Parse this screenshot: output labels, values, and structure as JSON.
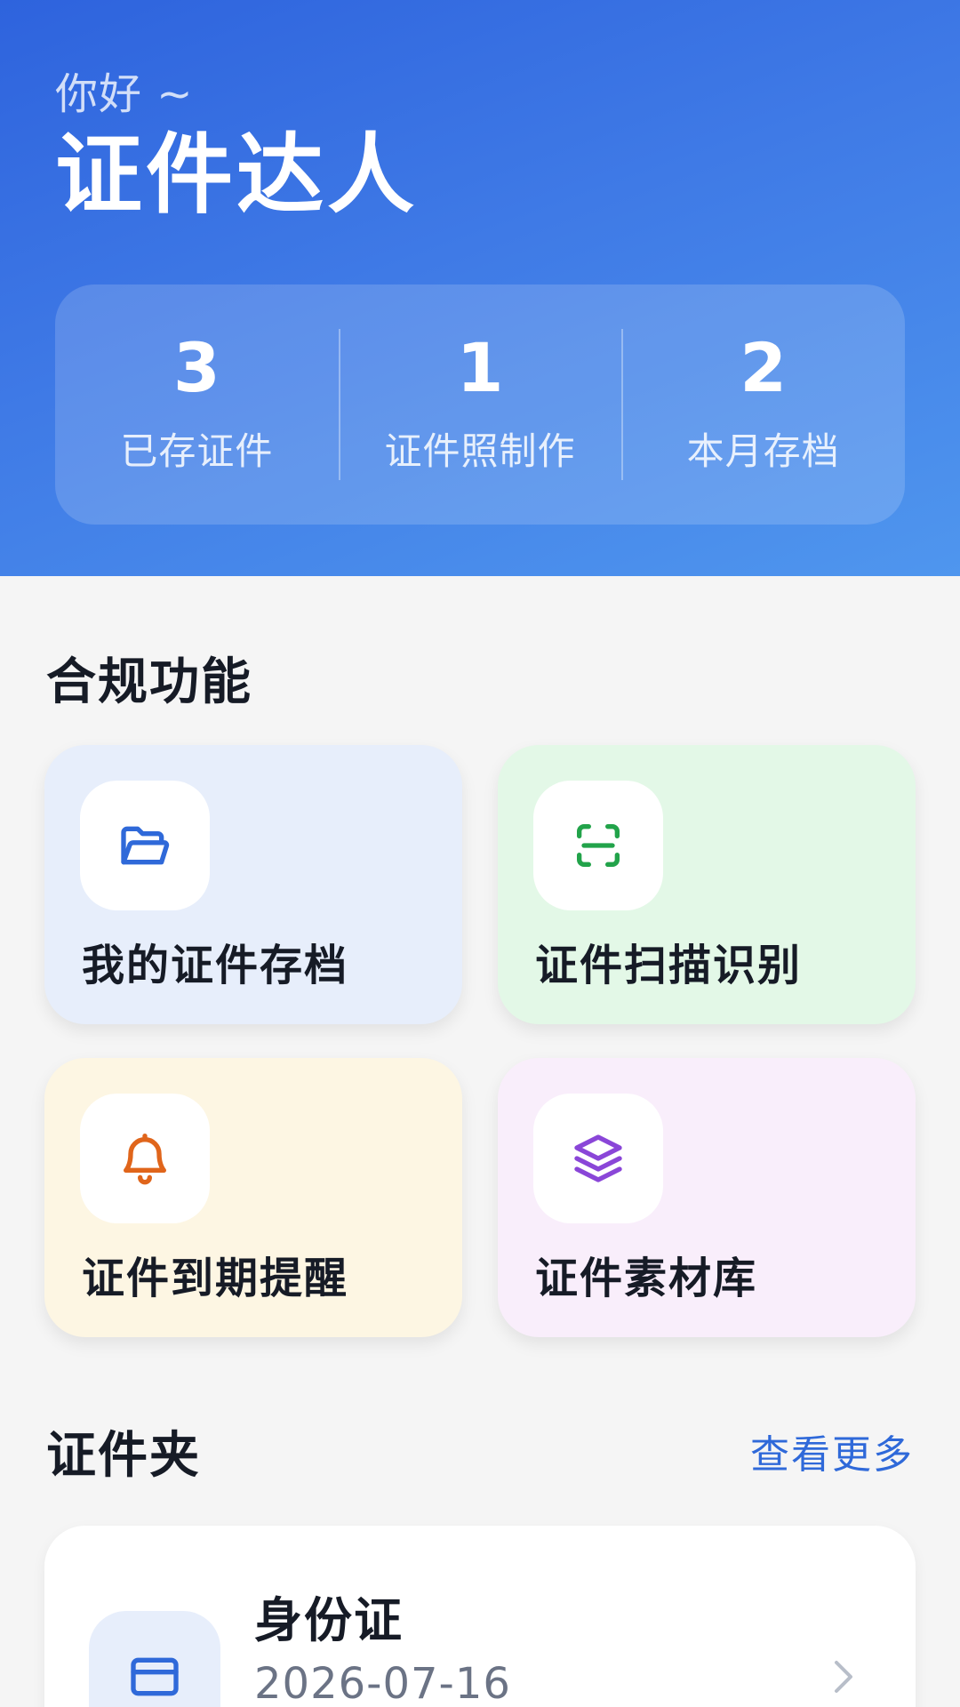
{
  "header": {
    "greeting": "你好 ~",
    "title": "证件达人"
  },
  "stats": [
    {
      "value": "3",
      "label": "已存证件"
    },
    {
      "value": "1",
      "label": "证件照制作"
    },
    {
      "value": "2",
      "label": "本月存档"
    }
  ],
  "features": {
    "title": "合规功能",
    "items": [
      {
        "label": "我的证件存档",
        "icon": "folder-open-icon",
        "color": "#2f69d9",
        "bg": "#e7eefb"
      },
      {
        "label": "证件扫描识别",
        "icon": "scan-icon",
        "color": "#22a34a",
        "bg": "#e3f8e7"
      },
      {
        "label": "证件到期提醒",
        "icon": "bell-icon",
        "color": "#e0651b",
        "bg": "#fdf6e3"
      },
      {
        "label": "证件素材库",
        "icon": "layers-icon",
        "color": "#8a46d8",
        "bg": "#f9eefb"
      }
    ]
  },
  "folder": {
    "title": "证件夹",
    "see_more": "查看更多",
    "items": [
      {
        "title": "身份证",
        "date": "2026-07-16",
        "icon": "id-card-icon"
      }
    ]
  },
  "colors": {
    "accent": "#2f69d9",
    "header_gradient_start": "#2e63dd",
    "header_gradient_end": "#4f96ee"
  }
}
